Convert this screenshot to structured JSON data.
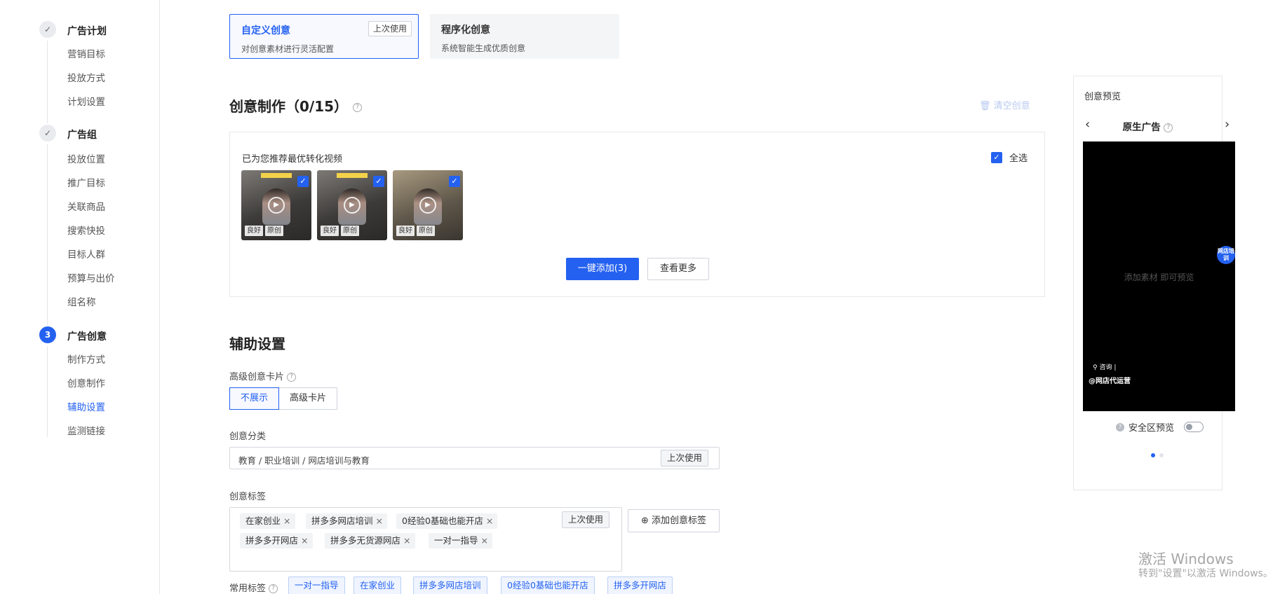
{
  "sidebar": {
    "steps": [
      {
        "marker": "✓",
        "title": "广告计划",
        "items": [
          "营销目标",
          "投放方式",
          "计划设置"
        ]
      },
      {
        "marker": "✓",
        "title": "广告组",
        "items": [
          "投放位置",
          "推广目标",
          "关联商品",
          "搜索快投",
          "目标人群",
          "预算与出价",
          "组名称"
        ]
      },
      {
        "marker": "3",
        "title": "广告创意",
        "items": [
          "制作方式",
          "创意制作",
          "辅助设置",
          "监测链接"
        ]
      }
    ],
    "active_item": "辅助设置"
  },
  "creative_types": {
    "custom": {
      "title": "自定义创意",
      "desc": "对创意素材进行灵活配置",
      "last_used": "上次使用"
    },
    "program": {
      "title": "程序化创意",
      "desc": "系统智能生成优质创意"
    }
  },
  "creative_make": {
    "title": "创意制作（0/15）",
    "help": "?",
    "clear": "清空创意",
    "recommend_label": "已为您推荐最优转化视频",
    "select_all": "全选",
    "check": "✓",
    "play": "▶",
    "videos": [
      {
        "badges": [
          "良好",
          "原创"
        ]
      },
      {
        "badges": [
          "良好",
          "原创"
        ]
      },
      {
        "badges": [
          "良好",
          "原创"
        ]
      }
    ],
    "add_button": "一键添加(3)",
    "more_button": "查看更多"
  },
  "assist": {
    "title": "辅助设置",
    "card_label": "高级创意卡片",
    "card_options": [
      "不展示",
      "高级卡片"
    ],
    "category_label": "创意分类",
    "category_value": "教育 / 职业培训 / 网店培训与教育",
    "last_used": "上次使用",
    "tags_label": "创意标签",
    "tags": [
      "在家创业",
      "拼多多网店培训",
      "0经验0基础也能开店",
      "拼多多开网店",
      "拼多多无货源网店",
      "一对一指导"
    ],
    "tag_close": "×",
    "add_tag": "添加创意标签",
    "add_icon": "⊕",
    "common_label": "常用标签",
    "common_tags": [
      "一对一指导",
      "在家创业",
      "拼多多网店培训",
      "0经验0基础也能开店",
      "拼多多开网店"
    ]
  },
  "preview": {
    "title": "创意预览",
    "prev": "‹",
    "next": "›",
    "type": "原生广告",
    "placeholder": "添加素材 即可预览",
    "brand": "网店培训",
    "ask": "咨询 |",
    "account": "@网店代运营",
    "safe_label": "安全区预览"
  },
  "watermark": {
    "line1": "激活 Windows",
    "line2": "转到\"设置\"以激活 Windows。"
  },
  "colors": {
    "accent": "#2461f0"
  }
}
